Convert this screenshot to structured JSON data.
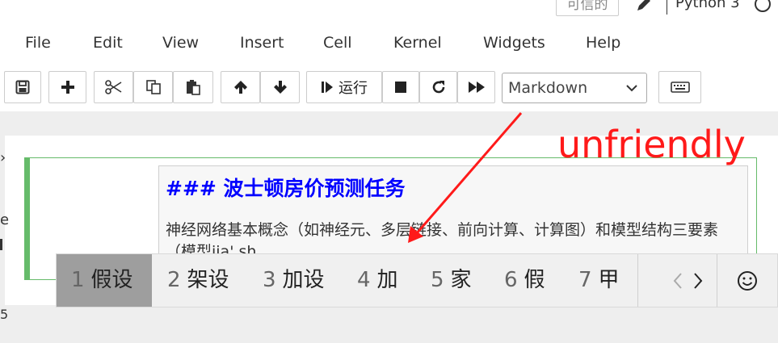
{
  "header": {
    "trusted_label": "可信的",
    "kernel_name": "Python 3"
  },
  "menu": {
    "items": [
      "File",
      "Edit",
      "View",
      "Insert",
      "Cell",
      "Kernel",
      "Widgets",
      "Help"
    ]
  },
  "toolbar": {
    "run_label": "运行",
    "cell_type": "Markdown"
  },
  "cell": {
    "heading": "### 波士顿房价预测任务",
    "body": "神经网络基本概念（如神经元、多层链接、前向计算、计算图）和模型结构三要素（模型jia' sh"
  },
  "ime": {
    "candidates": [
      {
        "num": "1",
        "text": "假设"
      },
      {
        "num": "2",
        "text": "架设"
      },
      {
        "num": "3",
        "text": "加设"
      },
      {
        "num": "4",
        "text": "加"
      },
      {
        "num": "5",
        "text": "家"
      },
      {
        "num": "6",
        "text": "假"
      },
      {
        "num": "7",
        "text": "甲"
      }
    ]
  },
  "annotation": {
    "text": "unfriendly",
    "color": "#ff1a1a"
  },
  "colors": {
    "selected_cell_border": "#66bb6a",
    "heading_color": "#0000ff",
    "ime_selected_bg": "#9e9e9e"
  }
}
